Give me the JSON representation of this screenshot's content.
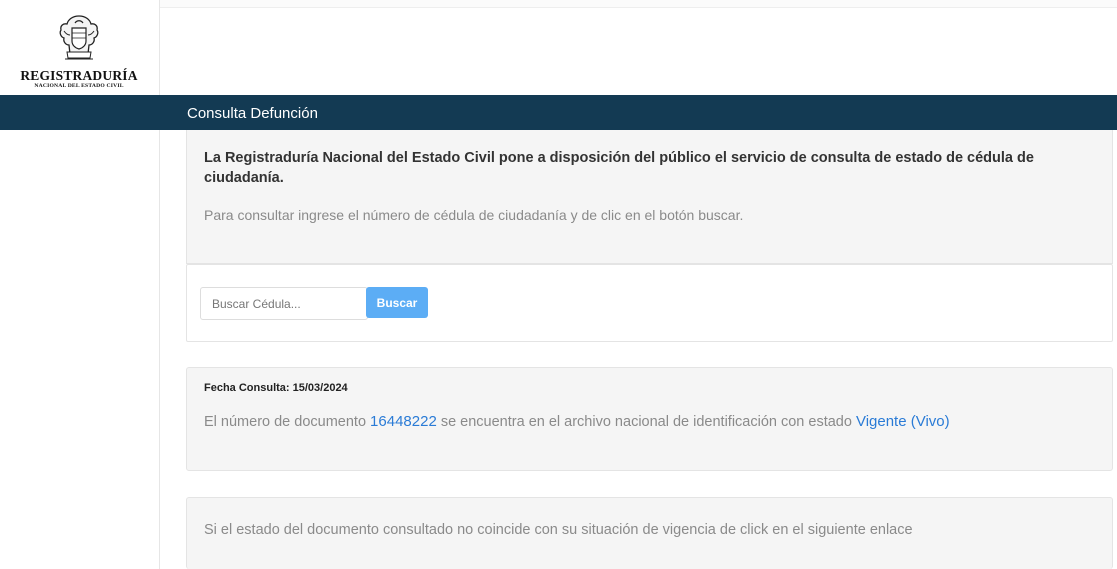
{
  "logo": {
    "title": "REGISTRADURÍA",
    "subtitle": "NACIONAL DEL ESTADO CIVIL"
  },
  "navbar": {
    "title": "Consulta Defunción"
  },
  "intro": {
    "text": "La Registraduría Nacional del Estado Civil pone a disposición del público el servicio de consulta de estado de cédula de ciudadanía.",
    "help": "Para consultar ingrese el número de cédula de ciudadanía y de clic en el botón buscar."
  },
  "search": {
    "placeholder": "Buscar Cédula...",
    "value": "",
    "button_label": "Buscar"
  },
  "result": {
    "fecha": "Fecha Consulta: 15/03/2024",
    "prefix": "El número de documento",
    "document_number": "16448222",
    "middle": "se encuentra en el archivo nacional de identificación con estado",
    "status": "Vigente (Vivo)"
  },
  "notice": {
    "text": "Si el estado del documento consultado no coincide con su situación de vigencia de click en el siguiente",
    "link_label": "enlace"
  },
  "colors": {
    "navbar": "#133a53",
    "button": "#5cadf5",
    "highlight": "#2a7bd6"
  }
}
